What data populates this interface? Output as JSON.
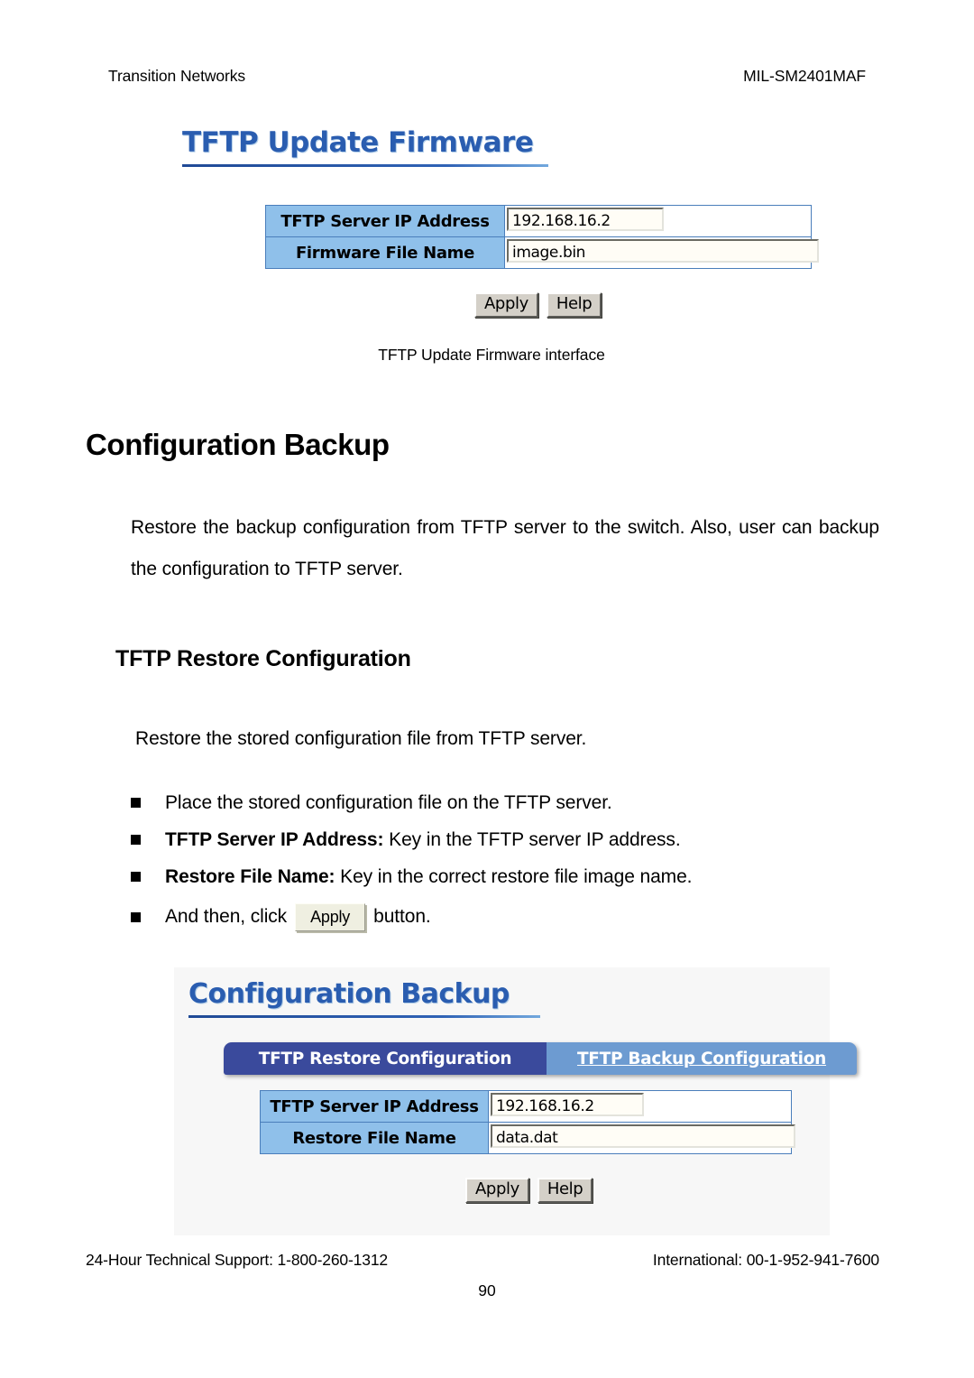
{
  "document": {
    "header": {
      "left": "Transition Networks",
      "right": "MIL-SM2401MAF"
    },
    "footer": {
      "left": "24-Hour Technical Support: 1-800-260-1312",
      "right": "International: 00-1-952-941-7600",
      "page_number": "90"
    },
    "section_heading": "Configuration Backup",
    "intro_paragraph": "Restore the backup configuration from TFTP server to the switch. Also, user can backup the configuration to TFTP server.",
    "subsection_heading": "TFTP Restore Configuration",
    "subsection_paragraph": "Restore the stored configuration file from TFTP server.",
    "bullets": [
      {
        "bold": "",
        "text": "Place the stored configuration file on the TFTP server."
      },
      {
        "bold": "TFTP Server IP Address:",
        "text": " Key in the TFTP server IP address."
      },
      {
        "bold": "Restore File Name:",
        "text": " Key in the correct restore file image name."
      }
    ],
    "bullet_button": {
      "before": "And then, click",
      "button_label": "Apply",
      "after": "button."
    },
    "figure_caption": "TFTP Update Firmware interface"
  },
  "firmware_screenshot": {
    "title": "TFTP Update Firmware",
    "rows": [
      {
        "label": "TFTP Server IP Address",
        "value": "192.168.16.2"
      },
      {
        "label": "Firmware File Name",
        "value": "image.bin"
      }
    ],
    "buttons": {
      "apply": "Apply",
      "help": "Help"
    }
  },
  "backup_screenshot": {
    "title": "Configuration Backup",
    "tabs": [
      {
        "label": "TFTP Restore Configuration",
        "state": "active"
      },
      {
        "label": "TFTP Backup Configuration",
        "state": "inactive"
      }
    ],
    "rows": [
      {
        "label": "TFTP Server IP Address",
        "value": "192.168.16.2"
      },
      {
        "label": "Restore File Name",
        "value": "data.dat"
      }
    ],
    "buttons": {
      "apply": "Apply",
      "help": "Help"
    }
  },
  "colors": {
    "ui_title_blue": "#2a5db0",
    "label_cell_blue": "#8fc0ea",
    "form_border_blue": "#4a7ebb",
    "tab_active_blue": "#3a4a9c",
    "tab_inactive_blue": "#6d9bd1",
    "button_face": "#d4d0c8"
  }
}
